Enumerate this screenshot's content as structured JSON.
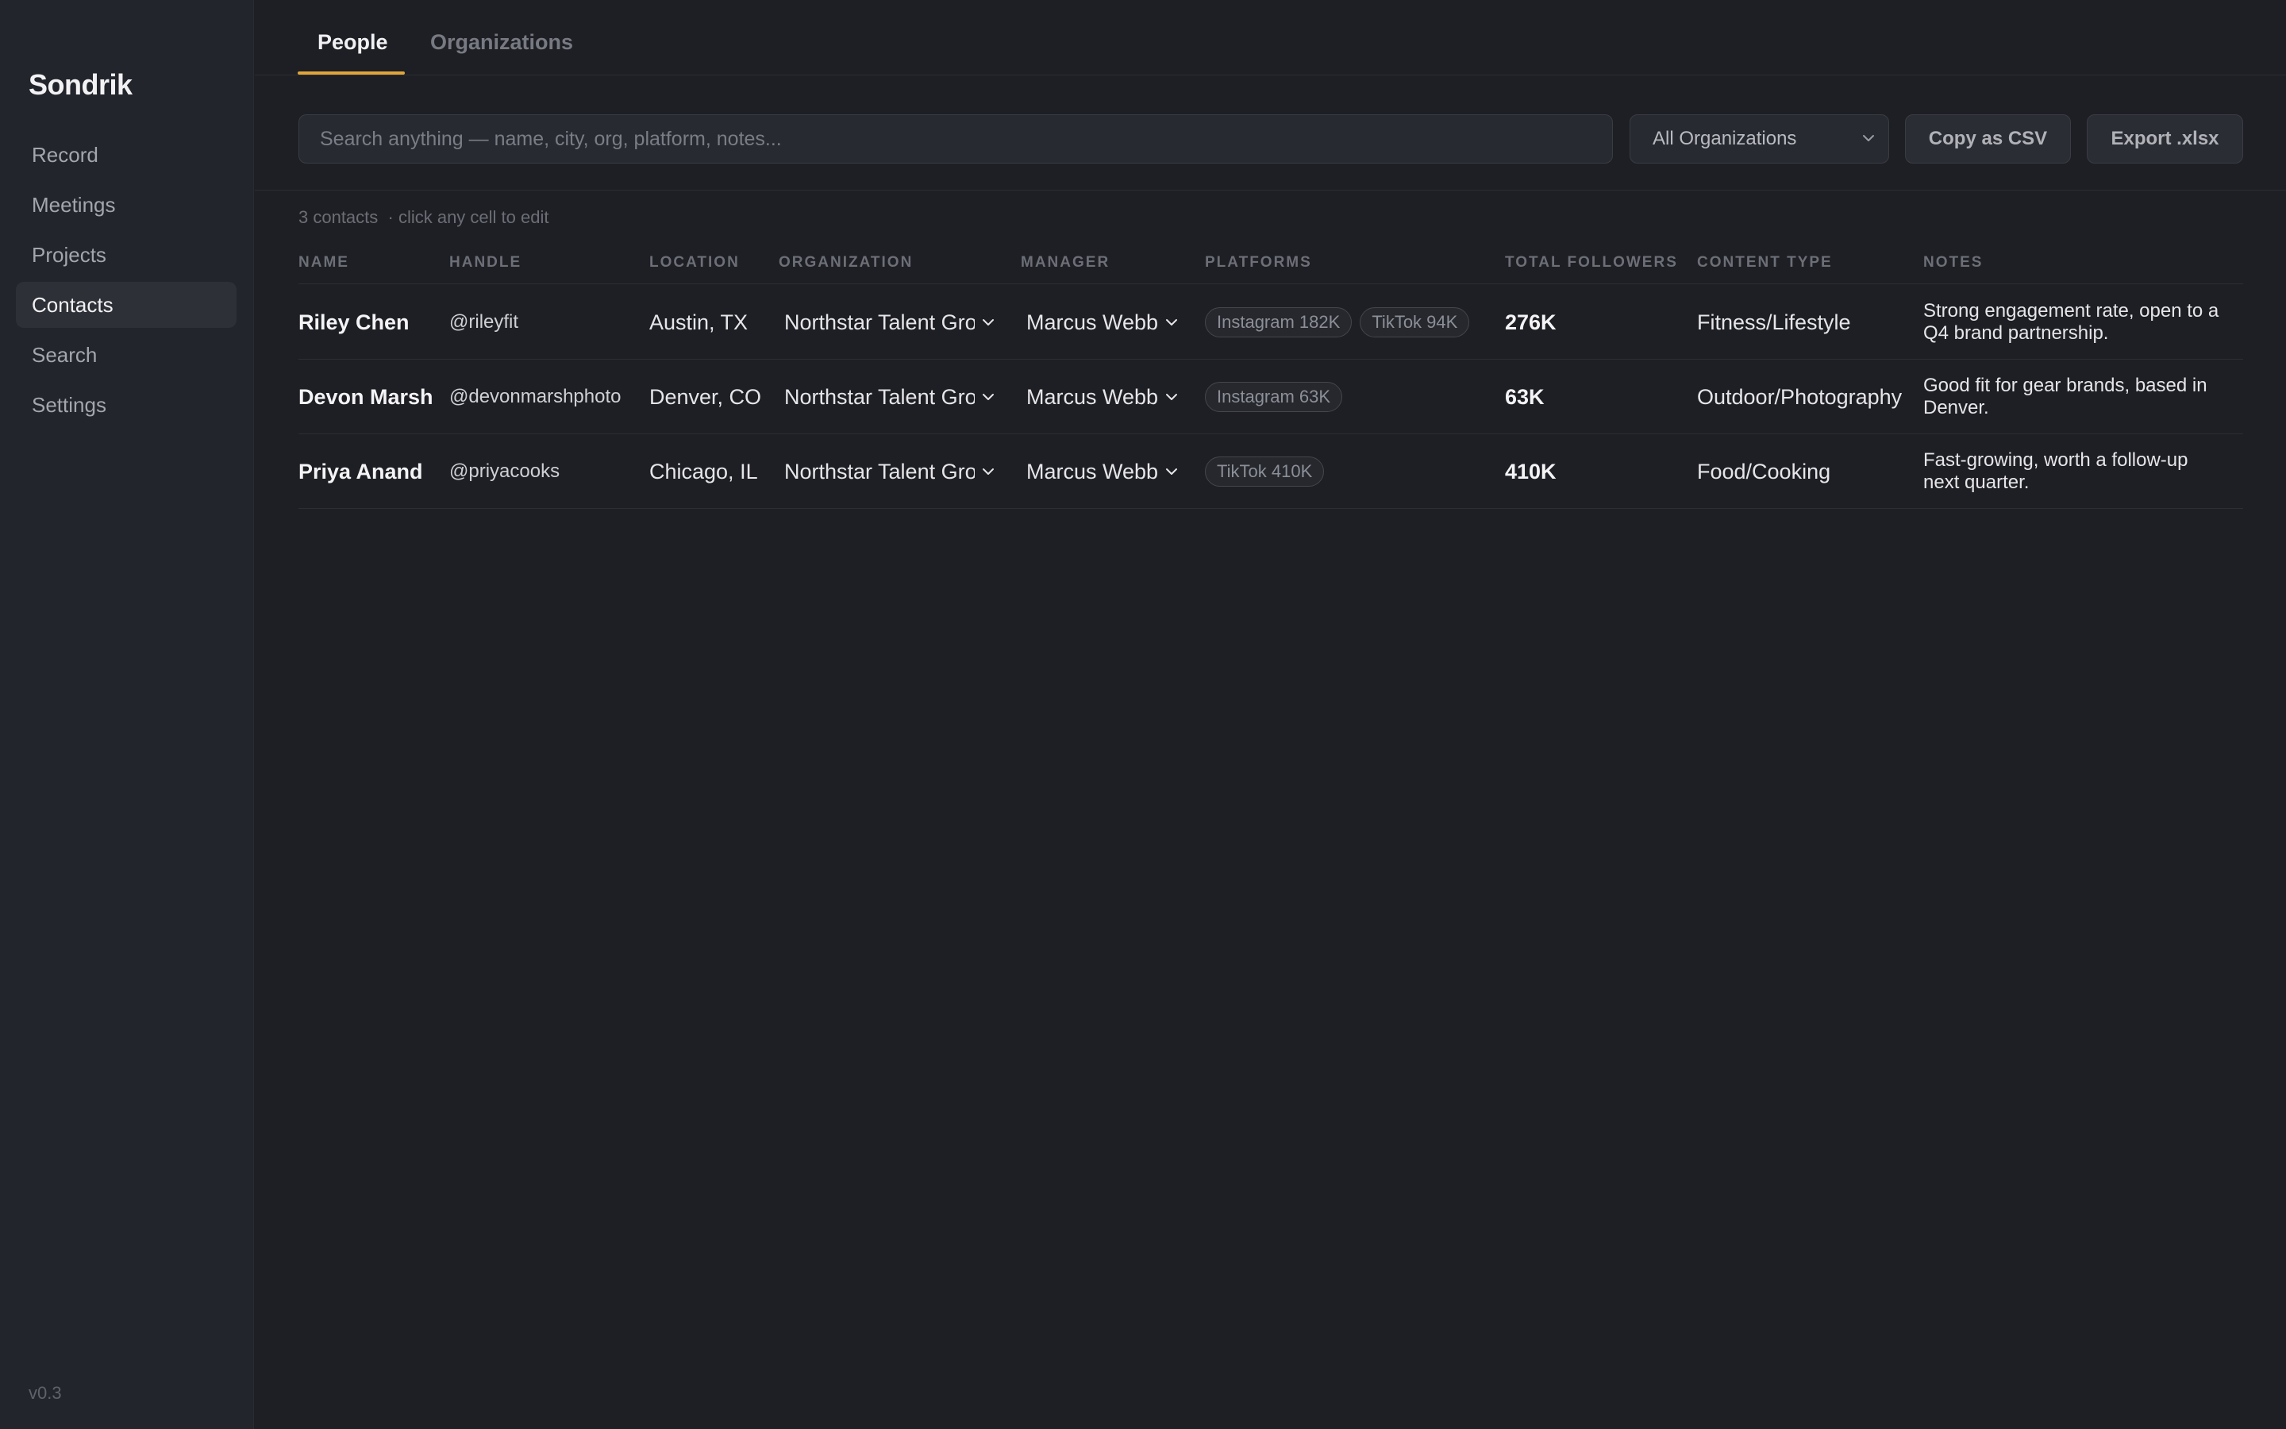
{
  "app": {
    "name": "Sondrik",
    "version": "v0.3"
  },
  "sidebar": {
    "items": [
      {
        "label": "Record",
        "active": false
      },
      {
        "label": "Meetings",
        "active": false
      },
      {
        "label": "Projects",
        "active": false
      },
      {
        "label": "Contacts",
        "active": true
      },
      {
        "label": "Search",
        "active": false
      },
      {
        "label": "Settings",
        "active": false
      }
    ]
  },
  "tabs": [
    {
      "label": "People",
      "active": true
    },
    {
      "label": "Organizations",
      "active": false
    }
  ],
  "toolbar": {
    "search_placeholder": "Search anything — name, city, org, platform, notes...",
    "search_value": "",
    "org_filter": "All Organizations",
    "copy_csv_label": "Copy as CSV",
    "export_label": "Export .xlsx"
  },
  "meta": {
    "summary": "3 contacts  · click any cell to edit"
  },
  "table": {
    "columns": [
      "NAME",
      "HANDLE",
      "LOCATION",
      "ORGANIZATION",
      "MANAGER",
      "PLATFORMS",
      "TOTAL FOLLOWERS",
      "CONTENT TYPE",
      "NOTES"
    ],
    "rows": [
      {
        "name": "Riley Chen",
        "handle": "@rileyfit",
        "location": "Austin, TX",
        "organization": "Northstar Talent Group",
        "manager": "Marcus Webb",
        "platforms": [
          "Instagram 182K",
          "TikTok 94K"
        ],
        "total_followers": "276K",
        "content_type": "Fitness/Lifestyle",
        "notes": "Strong engagement rate, open to a Q4 brand partnership."
      },
      {
        "name": "Devon Marsh",
        "handle": "@devonmarshphoto",
        "location": "Denver, CO",
        "organization": "Northstar Talent Group",
        "manager": "Marcus Webb",
        "platforms": [
          "Instagram 63K"
        ],
        "total_followers": "63K",
        "content_type": "Outdoor/Photography",
        "notes": "Good fit for gear brands, based in Denver."
      },
      {
        "name": "Priya Anand",
        "handle": "@priyacooks",
        "location": "Chicago, IL",
        "organization": "Northstar Talent Group",
        "manager": "Marcus Webb",
        "platforms": [
          "TikTok 410K"
        ],
        "total_followers": "410K",
        "content_type": "Food/Cooking",
        "notes": "Fast-growing, worth a follow-up next quarter."
      }
    ]
  },
  "colors": {
    "background": "#1e1f24",
    "sidebar": "#23252c",
    "accent": "#e0a53a",
    "text_primary": "#f4f4f6",
    "text_muted": "#6c6f77"
  },
  "icons": {
    "dropdown": "chevron-down-icon"
  }
}
